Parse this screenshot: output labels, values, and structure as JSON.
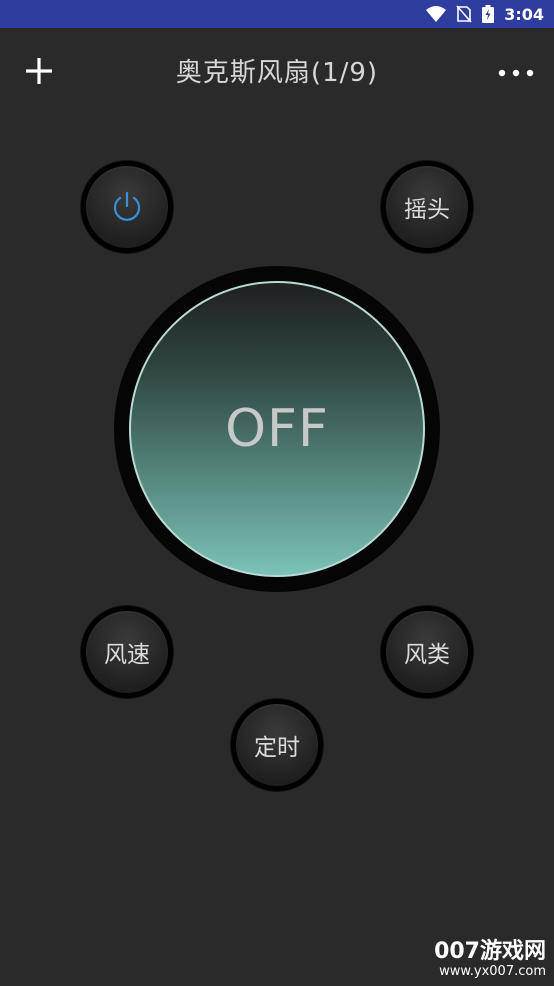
{
  "status_bar": {
    "time": "3:04",
    "icons": [
      "wifi-icon",
      "no-sim-icon",
      "battery-icon"
    ],
    "background_color": "#2e3d9e"
  },
  "header": {
    "title": "奥克斯风扇(1/9)",
    "add_icon": "plus-icon",
    "menu_icon": "more-dots-icon"
  },
  "controls": {
    "power_icon": "power-icon",
    "power_icon_color": "#3a8fd6",
    "swing_label": "摇头",
    "main_state": "OFF",
    "speed_label": "风速",
    "mode_label": "风类",
    "timer_label": "定时"
  },
  "watermark": {
    "brand": "007游戏网",
    "url": "www.yx007.com"
  }
}
